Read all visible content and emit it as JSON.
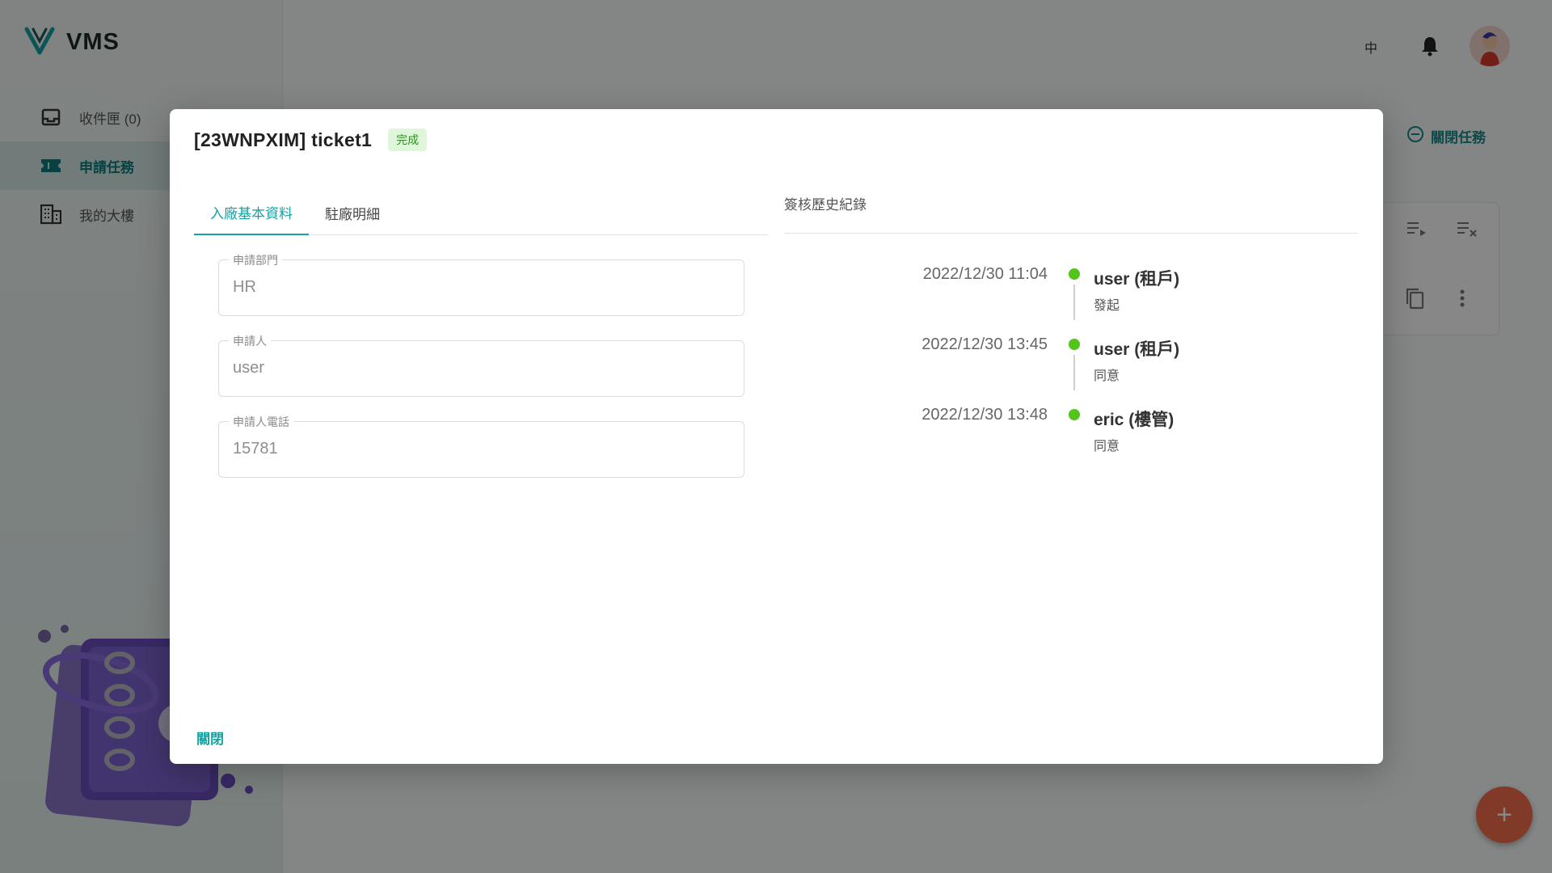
{
  "app": {
    "name": "VMS"
  },
  "sidebar": {
    "items": [
      {
        "label": "收件匣 (0)",
        "icon": "inbox-icon"
      },
      {
        "label": "申請任務",
        "icon": "ticket-icon",
        "active": true
      },
      {
        "label": "我的大樓",
        "icon": "building-icon"
      }
    ]
  },
  "topbar": {
    "lang": "中",
    "bell_icon": "bell-icon",
    "avatar_icon": "avatar"
  },
  "main": {
    "close_task_label": "關閉任務"
  },
  "modal": {
    "title": "[23WNPXIM] ticket1",
    "status": "完成",
    "tabs": [
      {
        "label": "入廠基本資料",
        "active": true
      },
      {
        "label": "駐廠明細",
        "active": false
      }
    ],
    "fields": [
      {
        "label": "申請部門",
        "value": "HR"
      },
      {
        "label": "申請人",
        "value": "user"
      },
      {
        "label": "申請人電話",
        "value": "15781"
      }
    ],
    "history": {
      "title": "簽核歷史紀錄",
      "entries": [
        {
          "time": "2022/12/30 11:04",
          "user": "user (租戶)",
          "action": "發起"
        },
        {
          "time": "2022/12/30 13:45",
          "user": "user (租戶)",
          "action": "同意"
        },
        {
          "time": "2022/12/30 13:48",
          "user": "eric (樓管)",
          "action": "同意"
        }
      ]
    },
    "close_label": "關閉"
  },
  "colors": {
    "accent": "#13a3a3",
    "success": "#52c41a",
    "fab": "#f36f4a"
  }
}
